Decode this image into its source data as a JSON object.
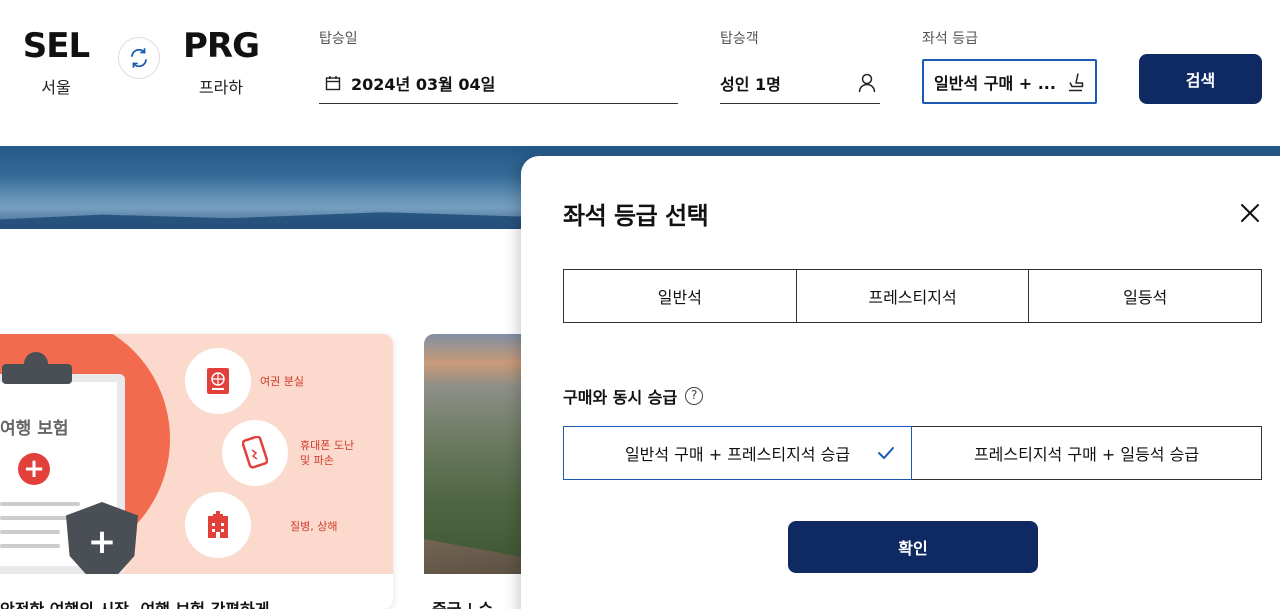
{
  "route": {
    "origin": {
      "code": "SEL",
      "city": "서울"
    },
    "destination": {
      "code": "PRG",
      "city": "프라하"
    }
  },
  "search": {
    "date_label": "탑승일",
    "date_value": "2024년 03월 04일",
    "passenger_label": "탑승객",
    "passenger_value": "성인 1명",
    "class_label": "좌석 등급",
    "class_value": "일반석 구매 + ...",
    "search_button": "검색"
  },
  "cards": {
    "insurance": {
      "art_title": "여행 보험",
      "items": [
        "여권 분실",
        "휴대폰 도난\n및 파손",
        "질병, 상해"
      ],
      "title": "안전한 여행의 시작, 여행 보험 간편하게"
    },
    "china": {
      "title": "중국 | 순"
    }
  },
  "modal": {
    "title": "좌석 등급 선택",
    "class_tabs": [
      "일반석",
      "프레스티지석",
      "일등석"
    ],
    "upgrade_label": "구매와 동시 승급",
    "upgrade_options": [
      {
        "label": "일반석 구매 + 프레스티지석 승급",
        "selected": true
      },
      {
        "label": "프레스티지석 구매 + 일등석 승급",
        "selected": false
      }
    ],
    "confirm_button": "확인"
  },
  "colors": {
    "primary": "#0f2a63",
    "selected_border": "#1a5ab0",
    "check": "#1a5ab0"
  },
  "icons": {
    "swap": "swap-icon",
    "calendar": "calendar-icon",
    "passenger": "person-icon",
    "seat": "seat-icon",
    "close": "close-icon",
    "help": "help-icon",
    "check": "check-icon"
  }
}
